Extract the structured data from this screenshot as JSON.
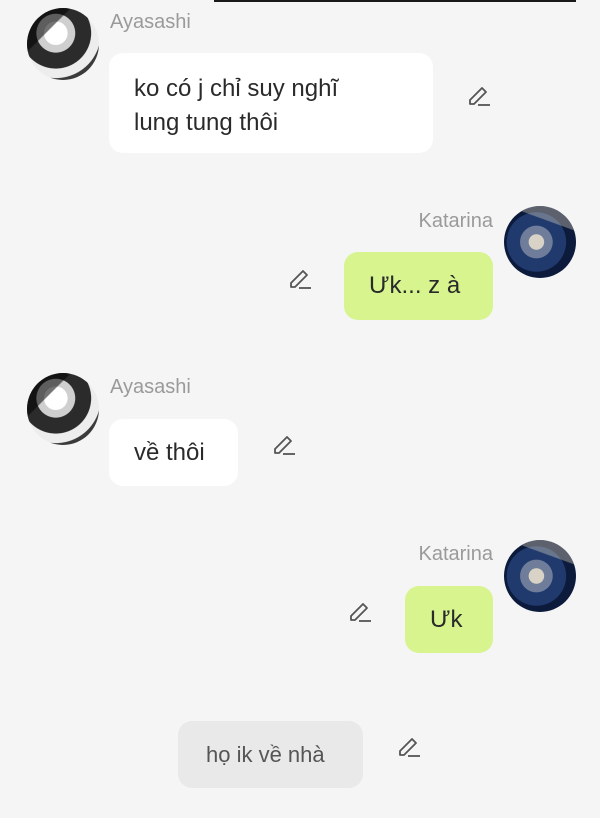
{
  "messages": [
    {
      "sender": "Ayasashi",
      "text": "ko có j chỉ suy nghĩ lung tung thôi",
      "line1": "ko có j chỉ suy nghĩ",
      "line2": "lung tung thôi"
    },
    {
      "sender": "Katarina",
      "text": "Ưk... z à"
    },
    {
      "sender": "Ayasashi",
      "text": "về thôi"
    },
    {
      "sender": "Katarina",
      "text": "Ưk"
    },
    {
      "sender": "",
      "text": "họ ik về nhà"
    }
  ],
  "colors": {
    "background": "#f5f5f5",
    "incoming_bubble": "#ffffff",
    "outgoing_bubble": "#d7f48f",
    "system_bubble": "#e9e9e9",
    "name_text": "#9a9a9a"
  },
  "icons": {
    "edit": "pencil-edit-icon"
  }
}
